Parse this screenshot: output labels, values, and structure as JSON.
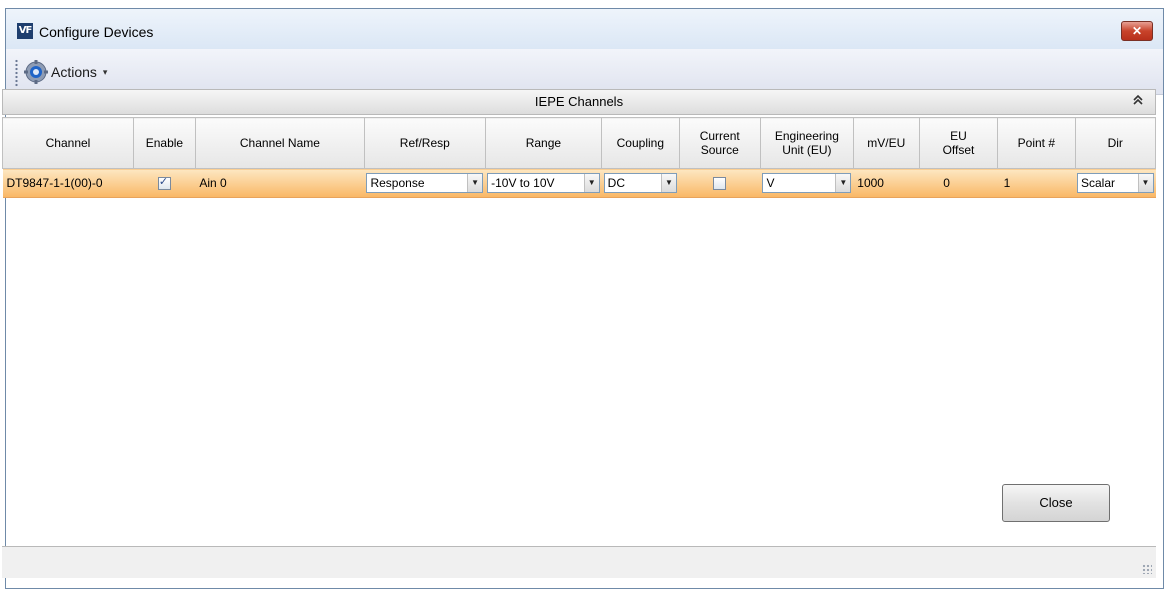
{
  "window": {
    "title": "Configure Devices",
    "app_icon_text": "VF",
    "close_glyph": "✕"
  },
  "toolbar": {
    "actions_label": "Actions",
    "caret": "▾"
  },
  "group": {
    "title": "IEPE Channels",
    "collapse_glyph": "≈"
  },
  "table": {
    "headers": {
      "channel": "Channel",
      "enable": "Enable",
      "channel_name": "Channel Name",
      "ref_resp": "Ref/Resp",
      "range": "Range",
      "coupling": "Coupling",
      "current_source_1": "Current",
      "current_source_2": "Source",
      "eu_1": "Engineering",
      "eu_2": "Unit (EU)",
      "mv_eu": "mV/EU",
      "eu_offset_1": "EU",
      "eu_offset_2": "Offset",
      "point": "Point #",
      "dir": "Dir"
    },
    "rows": [
      {
        "channel": "DT9847-1-1(00)-0",
        "enabled": true,
        "channel_name": "Ain 0",
        "ref_resp": "Response",
        "range": "-10V to 10V",
        "coupling": "DC",
        "current_source": false,
        "eu": "V",
        "mv_eu": "1000",
        "eu_offset": "0",
        "point": "1",
        "dir": "Scalar"
      }
    ]
  },
  "buttons": {
    "close": "Close"
  },
  "colors": {
    "row_selected": "#f9b765",
    "title_bar": "#dbe7f5",
    "close_red": "#c8432b"
  },
  "icons": {
    "toolbar_gear": "gear-icon",
    "combo_arrow": "▼"
  }
}
